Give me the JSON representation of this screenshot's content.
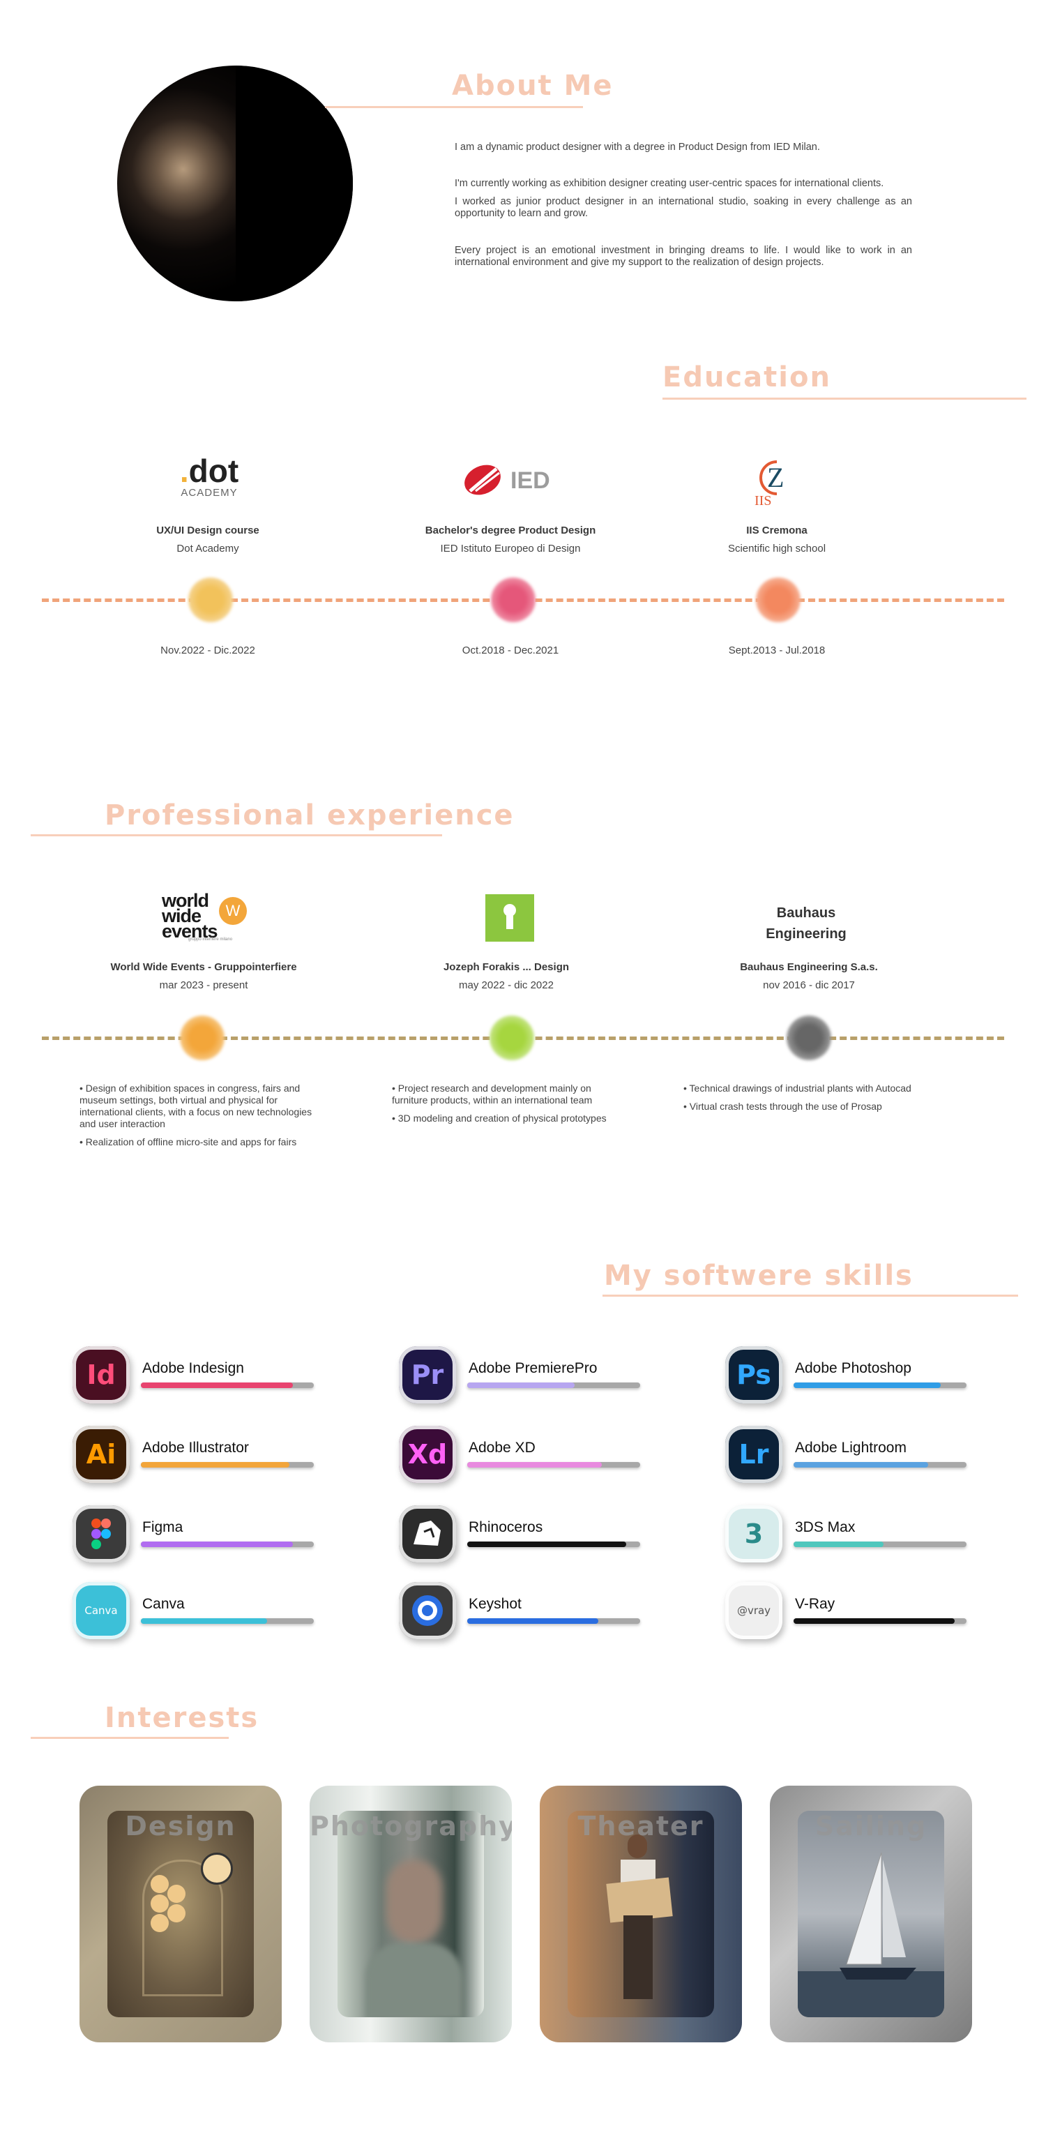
{
  "about": {
    "title": "About Me",
    "paragraphs": [
      "I am a dynamic product designer with a degree in Product Design from IED Milan.",
      "I'm currently working as exhibition designer creating user-centric spaces for international clients.",
      "I worked as junior product designer in an international studio, soaking in every challenge as an opportunity to learn and grow.",
      "Every project is an emotional investment in bringing dreams to life. I would like to work in an international environment and give my support to the realization of  design projects."
    ]
  },
  "education": {
    "title": "Education",
    "items": [
      {
        "logo_main": ".dot",
        "logo_sub": "ACADEMY",
        "title": "UX/UI Design course",
        "subtitle": "Dot Academy",
        "date": "Nov.2022 - Dic.2022",
        "color": "#f2c25b"
      },
      {
        "logo_main": "IED",
        "logo_sub": "",
        "title": "Bachelor's degree Product Design",
        "subtitle": "IED Istituto Europeo di Design",
        "date": "Oct.2018 - Dec.2021",
        "color": "#e5577a"
      },
      {
        "logo_main": "CZ",
        "logo_sub": "IIS",
        "title": "IIS Cremona",
        "subtitle": "Scientific high school",
        "date": "Sept.2013 - Jul.2018",
        "color": "#f3885f"
      }
    ]
  },
  "experience": {
    "title": "Professional experience",
    "items": [
      {
        "logo_text": "world wide events",
        "logo_sub": "gruppo interfiere milano",
        "title": "World Wide Events - Gruppointerfiere",
        "date": "mar 2023 - present",
        "color": "#f3a63a",
        "bullets": [
          "• Design of exhibition spaces in congress, fairs and museum settings, both virtual and physical for international clients, with a focus on new technologies and user interaction",
          "• Realization of offline micro-site and apps for fairs"
        ]
      },
      {
        "logo_text": "",
        "logo_sub": "",
        "title": "Jozeph Forakis ... Design",
        "date": "may 2022 - dic 2022",
        "color": "#a6d63f",
        "bullets": [
          "• Project research and development mainly on furniture products, within an international team",
          "• 3D modeling and creation of physical prototypes"
        ]
      },
      {
        "logo_text": "Bauhaus Engineering",
        "logo_sub": "",
        "title": "Bauhaus Engineering S.a.s.",
        "date": "nov 2016 - dic 2017",
        "color": "#777777",
        "bullets": [
          "• Technical drawings of industrial plants with Autocad",
          "• Virtual crash tests through the use of Prosap"
        ]
      }
    ]
  },
  "skills": {
    "title": "My softwere skills",
    "items": [
      {
        "name": "Adobe Indesign",
        "abbr": "Id",
        "level": 0.88,
        "color": "#e8446f",
        "bg": "#4a0f22",
        "fg": "#ff4d7a"
      },
      {
        "name": "Adobe PremierePro",
        "abbr": "Pr",
        "level": 0.62,
        "color": "#b7a6f0",
        "bg": "#1e1746",
        "fg": "#9b8ff7"
      },
      {
        "name": "Adobe Photoshop",
        "abbr": "Ps",
        "level": 0.85,
        "color": "#2f9de6",
        "bg": "#0c2138",
        "fg": "#31a8ff"
      },
      {
        "name": "Adobe Illustrator",
        "abbr": "Ai",
        "level": 0.86,
        "color": "#f2a53a",
        "bg": "#3a1c04",
        "fg": "#ff9a00"
      },
      {
        "name": "Adobe XD",
        "abbr": "Xd",
        "level": 0.78,
        "color": "#e88adf",
        "bg": "#3b0b38",
        "fg": "#ff61f6"
      },
      {
        "name": "Adobe Lightroom",
        "abbr": "Lr",
        "level": 0.78,
        "color": "#5aa2e0",
        "bg": "#0c2138",
        "fg": "#31a8ff"
      },
      {
        "name": "Figma",
        "abbr": "",
        "level": 0.88,
        "color": "#b16df0",
        "bg": "#3b3b3b",
        "fg": "#ffffff"
      },
      {
        "name": "Rhinoceros",
        "abbr": "",
        "level": 0.92,
        "color": "#111111",
        "bg": "#2c2c2c",
        "fg": "#ffffff"
      },
      {
        "name": "3DS Max",
        "abbr": "3",
        "level": 0.52,
        "color": "#4fc7bd",
        "bg": "#d7ecec",
        "fg": "#2a8b8a"
      },
      {
        "name": "Canva",
        "abbr": "Canva",
        "level": 0.73,
        "color": "#3cc0d8",
        "bg": "#3cc0d8",
        "fg": "#ffffff"
      },
      {
        "name": "Keyshot",
        "abbr": "",
        "level": 0.76,
        "color": "#2a6de0",
        "bg": "#3b3b3b",
        "fg": "#ffffff"
      },
      {
        "name": "V-Ray",
        "abbr": "@vray",
        "level": 0.93,
        "color": "#111111",
        "bg": "#efefef",
        "fg": "#555555"
      }
    ]
  },
  "interests": {
    "title": "Interests",
    "items": [
      {
        "label": "Design"
      },
      {
        "label": "Photography"
      },
      {
        "label": "Theater"
      },
      {
        "label": "Sailing"
      }
    ]
  }
}
